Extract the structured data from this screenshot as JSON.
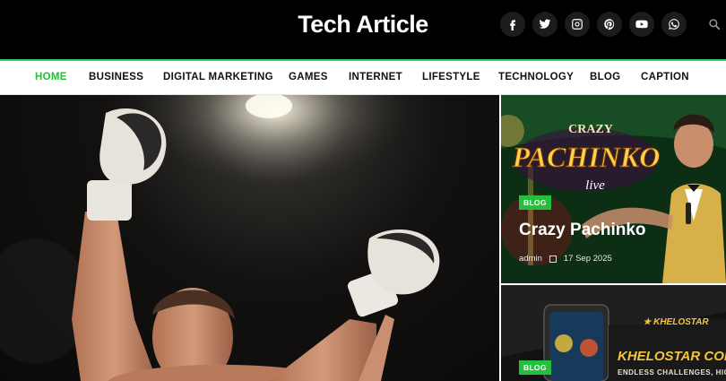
{
  "site": {
    "title": "Tech Article"
  },
  "header": {
    "social": [
      "facebook",
      "twitter",
      "instagram",
      "pinterest",
      "youtube",
      "whatsapp"
    ],
    "search_icon": "search-icon"
  },
  "nav": {
    "items": [
      {
        "label": "HOME",
        "active": true
      },
      {
        "label": "BUSINESS"
      },
      {
        "label": "DIGITAL MARKETING"
      },
      {
        "label": "GAMES"
      },
      {
        "label": "INTERNET"
      },
      {
        "label": "LIFESTYLE"
      },
      {
        "label": "TECHNOLOGY"
      },
      {
        "label": "BLOG"
      },
      {
        "label": "CAPTION"
      }
    ]
  },
  "cards": [
    {
      "tag": "BLOG",
      "title": "Crazy Pachinko",
      "author": "admin",
      "date": "17 Sep 2025",
      "art_logo": "CRAZY PACHINKO live"
    },
    {
      "tag": "BLOG",
      "art_logo": "KHELOSTAR CONTEST P",
      "art_subtitle": "ENDLESS CHALLENGES, HIG"
    }
  ],
  "colors": {
    "accent": "#22c03d",
    "header_bg": "#000000"
  }
}
